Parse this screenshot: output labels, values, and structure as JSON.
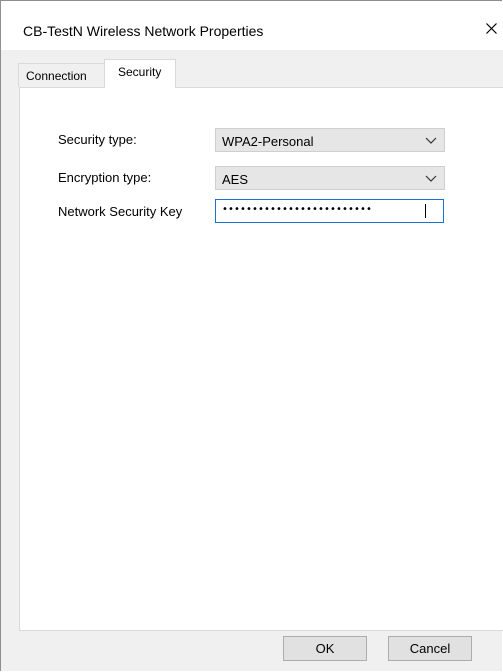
{
  "window": {
    "title": "CB-TestN Wireless Network Properties",
    "close_icon": "close-icon"
  },
  "tabs": [
    {
      "label": "Connection",
      "selected": false
    },
    {
      "label": "Security",
      "selected": true
    }
  ],
  "security": {
    "security_type_label": "Security type:",
    "security_type_value": "WPA2-Personal",
    "encryption_type_label": "Encryption type:",
    "encryption_type_value": "AES",
    "network_key_label": "Network Security Key",
    "network_key_masked": "•••••••••••••••••••••••••"
  },
  "buttons": {
    "ok": "OK",
    "cancel": "Cancel"
  },
  "icons": {
    "dropdown": "chevron-down-icon"
  },
  "colors": {
    "focus_border": "#1a73cf",
    "dialog_background": "#f0f0f0",
    "combo_background": "#e6e6e6"
  }
}
